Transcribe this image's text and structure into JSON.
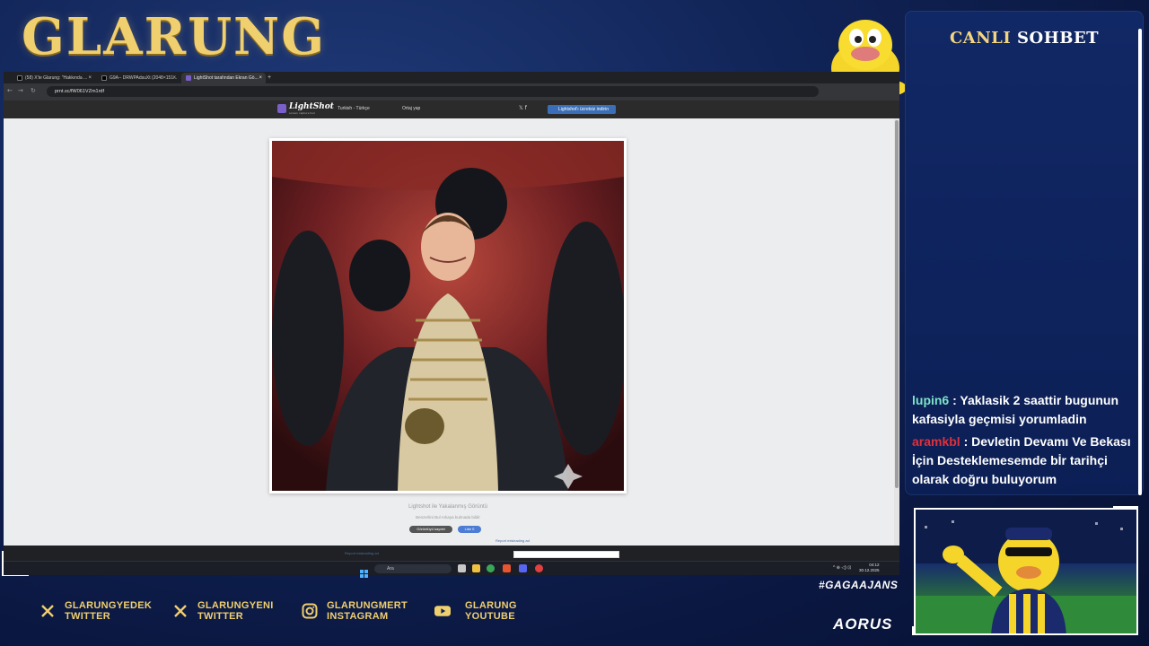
{
  "overlay": {
    "logo": "GLARUNG",
    "chat_title_part1": "CANLI",
    "chat_title_part2": "SOHBET",
    "hashtag": "#GAGAAJANS",
    "sponsor": "AORUS",
    "chat": [
      {
        "user": "lupin6",
        "user_color": "#7ee2c8",
        "message": " : Yaklasik 2 saattir bugunun kafasiyla geçmisi yorumladin"
      },
      {
        "user": "aramkbl",
        "user_color": "#e0303a",
        "message": " : Devletin Devamı Ve Bekası İçin Desteklemesemde bİr tarihçi olarak doğru buluyorum"
      }
    ],
    "socials": [
      {
        "icon": "x-icon",
        "line1": "GLARUNGYEDEK",
        "line2": "TWITTER"
      },
      {
        "icon": "x-icon",
        "line1": "GLARUNGYENI",
        "line2": "TWITTER"
      },
      {
        "icon": "instagram-icon",
        "line1": "GLARUNGMERT",
        "line2": "INSTAGRAM"
      },
      {
        "icon": "youtube-icon",
        "line1": "GLARUNG",
        "line2": "YOUTUBE"
      }
    ]
  },
  "browser": {
    "tabs": [
      {
        "title": "(58) X'te Glarung: \"Hakkında ...",
        "active": false
      },
      {
        "title": "G9A-- DRWPAdsuXt (2048×151...",
        "active": false
      },
      {
        "title": "LightShot tarafından Ekran Gö...",
        "active": true
      }
    ],
    "new_tab": "+",
    "url": "prnt.sc/fW061VZm1rdf",
    "lightshot": {
      "logo": "LightShot",
      "tagline": "screen capture tool",
      "language": "Turkish - Türkçe",
      "link": "Ortaj yap",
      "download_button": "Lightshot'ı ücretsiz indirin",
      "caption_title": "Lightshot ile Yakalanmış Görüntü",
      "caption_sub": "Benzerlini Bul   Arkaya bulmada bildir",
      "share_button": "Görüntüyü kaydet",
      "like_button": "Like 0",
      "report": "Report misleading ad"
    }
  },
  "taskbar": {
    "search_placeholder": "Ara",
    "time": "04:12",
    "date": "30.12.2025",
    "sys": "^  ⊕  ◁)  ⊡"
  }
}
